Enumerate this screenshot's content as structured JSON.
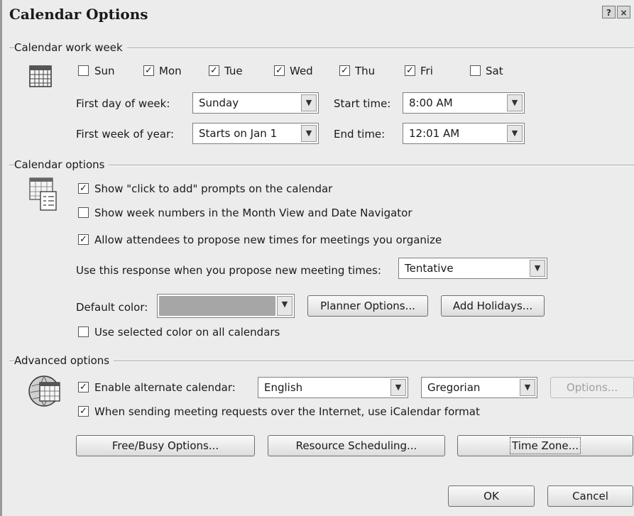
{
  "window": {
    "title": "Calendar Options",
    "help_glyph": "?",
    "close_glyph": "×"
  },
  "work_week": {
    "header": "Calendar work week",
    "days": [
      {
        "label": "Sun",
        "checked": false
      },
      {
        "label": "Mon",
        "checked": true
      },
      {
        "label": "Tue",
        "checked": true
      },
      {
        "label": "Wed",
        "checked": true
      },
      {
        "label": "Thu",
        "checked": true
      },
      {
        "label": "Fri",
        "checked": true
      },
      {
        "label": "Sat",
        "checked": false
      }
    ],
    "first_day_label": "First day of week:",
    "first_day_value": "Sunday",
    "first_week_label": "First week of year:",
    "first_week_value": "Starts on Jan 1",
    "start_time_label": "Start time:",
    "start_time_value": "8:00 AM",
    "end_time_label": "End time:",
    "end_time_value": "12:01 AM"
  },
  "calendar_options": {
    "header": "Calendar options",
    "show_click_to_add": {
      "label": "Show \"click to add\" prompts on the calendar",
      "checked": true
    },
    "show_week_numbers": {
      "label": "Show week numbers in the Month View and Date Navigator",
      "checked": false
    },
    "allow_propose": {
      "label": "Allow attendees to propose new times for meetings you organize",
      "checked": true
    },
    "response_label": "Use this response when you propose new meeting times:",
    "response_value": "Tentative",
    "default_color_label": "Default color:",
    "default_color_value": "#a6a6a6",
    "planner_button": "Planner Options...",
    "holidays_button": "Add Holidays...",
    "use_selected_color": {
      "label": "Use selected color on all calendars",
      "checked": false
    }
  },
  "advanced": {
    "header": "Advanced options",
    "alternate": {
      "label": "Enable alternate calendar:",
      "checked": true
    },
    "language_value": "English",
    "calendar_type_value": "Gregorian",
    "options_button": "Options...",
    "icalendar": {
      "label": "When sending meeting requests over the Internet, use iCalendar format",
      "checked": true
    },
    "freebusy_button": "Free/Busy Options...",
    "resource_button": "Resource Scheduling...",
    "timezone_button": "Time Zone..."
  },
  "footer": {
    "ok_button": "OK",
    "cancel_button": "Cancel"
  }
}
